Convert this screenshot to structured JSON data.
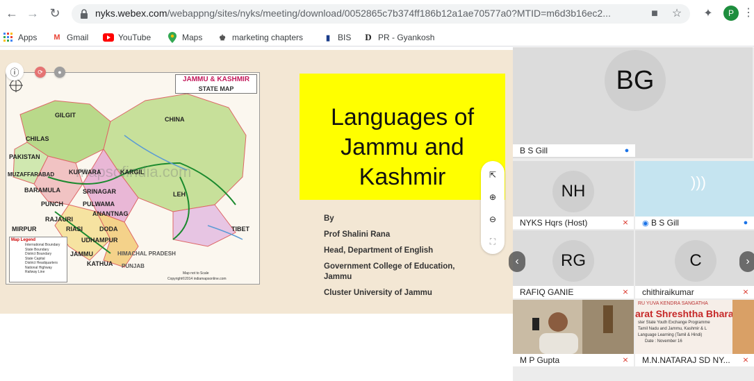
{
  "browser": {
    "url_host": "nyks.webex.com",
    "url_path": "/webappng/sites/nyks/meeting/download/0052865c7b374ff186b12a1ae70577a0?MTID=m6d3b16ec2...",
    "profile_initial": "P",
    "icons": [
      "back-icon",
      "forward-icon",
      "reload-icon",
      "lock-icon",
      "camera-icon",
      "star-icon",
      "extensions-icon",
      "menu-icon"
    ]
  },
  "bookmarks": [
    {
      "label": "Apps",
      "icon": "apps-grid-icon"
    },
    {
      "label": "Gmail",
      "icon": "gmail-icon"
    },
    {
      "label": "YouTube",
      "icon": "youtube-icon"
    },
    {
      "label": "Maps",
      "icon": "maps-pin-icon"
    },
    {
      "label": "marketing chapters",
      "icon": "bookmark-site-icon"
    },
    {
      "label": "BIS",
      "icon": "bookmark-site-icon"
    },
    {
      "label": "PR - Gyankosh",
      "icon": "bookmark-site-icon"
    }
  ],
  "slide": {
    "map": {
      "title_line1": "JAMMU & KASHMIR",
      "title_line2": "STATE MAP",
      "watermark": "mapsofindia.com",
      "places": [
        "GILGIT",
        "CHINA",
        "CHILAS",
        "PAKISTAN",
        "KUPWARA",
        "KARGIL",
        "MUZAFFARABAD",
        "BARAMULA",
        "SRINAGAR",
        "LEH",
        "PUNCH",
        "PULWAMA",
        "ANANTNAG",
        "RAJAURI",
        "MIRPUR",
        "RIASI",
        "DODA",
        "UDHAMPUR",
        "TIBET",
        "JAMMU",
        "KATHUA",
        "HIMACHAL PRADESH",
        "PUNJAB"
      ],
      "legend_title": "Map Legend",
      "legend_items": [
        "International Boundary",
        "State Boundary",
        "District Boundary",
        "State Capital",
        "District Headquarters",
        "National Highway",
        "Railway Line"
      ],
      "note": "Map not to Scale",
      "copyright": "Copyright©2014 indiamapsonline.com"
    },
    "title_lines": [
      "Languages of",
      "Jammu and",
      "Kashmir"
    ],
    "byline": [
      "By",
      "Prof Shalini Rana",
      "Head, Department of English",
      "Government College of Education,",
      "Jammu",
      "Cluster University of Jammu"
    ]
  },
  "participants": [
    {
      "initials": "BG",
      "name": "B S Gill",
      "mic": "on"
    },
    {
      "initials": "NH",
      "name": "NYKS Hqrs (Host)",
      "mic": "muted"
    },
    {
      "initials": "",
      "name": "B S Gill",
      "mic": "on",
      "speaking": true
    },
    {
      "initials": "RG",
      "name": "RAFIQ GANIE",
      "mic": "muted"
    },
    {
      "initials": "C",
      "name": "chithiraikumar",
      "mic": "muted"
    },
    {
      "initials": "",
      "name": "M P Gupta",
      "mic": "muted",
      "video": true
    },
    {
      "initials": "",
      "name": "M.N.NATARAJ SD NY...",
      "mic": "muted",
      "video": true,
      "banner_text": [
        "RU YUVA KENDRA SANGATHA",
        "arat Shreshtha Bharat",
        "ster State Youth Exchange Programme",
        "Tamil Nadu and Jammu, Kashmir & L",
        "Language Learning (Tamil & Hindi)",
        "Date : November 16"
      ]
    }
  ],
  "colors": {
    "slide_bg": "#f3e7d4",
    "title_box": "#ffff00",
    "muted": "#d93025",
    "mic_on": "#1a73e8",
    "avatar": "#cfcfcf"
  }
}
